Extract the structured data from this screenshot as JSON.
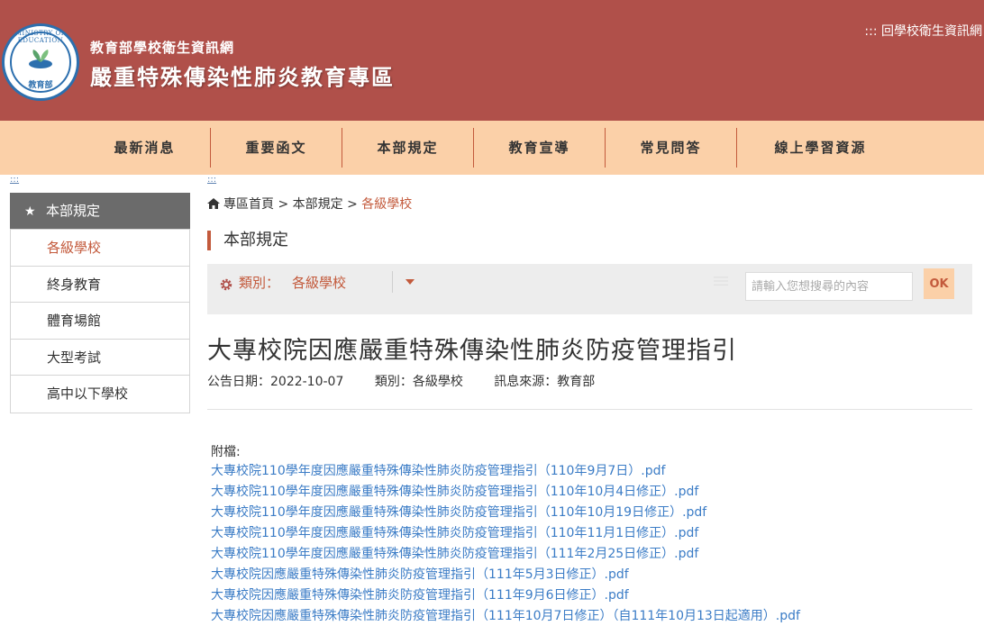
{
  "header": {
    "subtitle": "教育部學校衛生資訊網",
    "title": "嚴重特殊傳染性肺炎教育專區",
    "top_link": "::: 回學校衛生資訊網",
    "logo_ring_text": "MINISTRY OF EDUCATION",
    "logo_seal_text": "教育部"
  },
  "nav": {
    "items": [
      {
        "label": "最新消息"
      },
      {
        "label": "重要函文"
      },
      {
        "label": "本部規定"
      },
      {
        "label": "教育宣導"
      },
      {
        "label": "常見問答"
      },
      {
        "label": "線上學習資源"
      }
    ]
  },
  "accesskey": ":::",
  "sidebar": {
    "heading": "本部規定",
    "items": [
      {
        "label": "各級學校",
        "active": true
      },
      {
        "label": "終身教育"
      },
      {
        "label": "體育場館"
      },
      {
        "label": "大型考試"
      },
      {
        "label": "高中以下學校"
      }
    ]
  },
  "breadcrumb": {
    "home": "專區首頁",
    "sep1": ">",
    "level1": "本部規定",
    "sep2": ">",
    "current": "各級學校"
  },
  "section_title": "本部規定",
  "filter": {
    "label": "類別：",
    "value": "各級學校",
    "search_placeholder": "請輸入您想搜尋的內容",
    "ok_label": "OK"
  },
  "article": {
    "title": "大專校院因應嚴重特殊傳染性肺炎防疫管理指引",
    "date": "公告日期：2022-10-07",
    "category": "類別：各級學校",
    "source": "訊息來源：教育部",
    "attachments_label": "附檔:",
    "attachments": [
      "大專校院110學年度因應嚴重特殊傳染性肺炎防疫管理指引（110年9月7日）.pdf",
      "大專校院110學年度因應嚴重特殊傳染性肺炎防疫管理指引（110年10月4日修正）.pdf",
      "大專校院110學年度因應嚴重特殊傳染性肺炎防疫管理指引（110年10月19日修正）.pdf",
      "大專校院110學年度因應嚴重特殊傳染性肺炎防疫管理指引（110年11月1日修正）.pdf",
      "大專校院110學年度因應嚴重特殊傳染性肺炎防疫管理指引（111年2月25日修正）.pdf",
      "大專校院因應嚴重特殊傳染性肺炎防疫管理指引（111年5月3日修正）.pdf",
      "大專校院因應嚴重特殊傳染性肺炎防疫管理指引（111年9月6日修正）.pdf",
      "大專校院因應嚴重特殊傳染性肺炎防疫管理指引（111年10月7日修正）（自111年10月13日起適用）.pdf"
    ]
  },
  "colors": {
    "header_bg": "#b0504a",
    "nav_bg": "#fbd0a8",
    "accent": "#c35a3c",
    "link": "#3b7cc6",
    "sidebar_head_bg": "#6b6b6b"
  }
}
